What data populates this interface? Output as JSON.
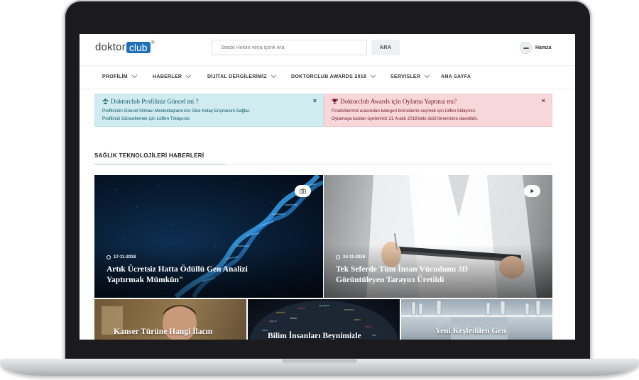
{
  "header": {
    "logo_doktor": "doktor",
    "logo_club": "club",
    "logo_reg": "®",
    "search_placeholder": "Sitede Hekim veya İçerik Ara",
    "search_button": "ARA",
    "user_name": "Hamza"
  },
  "nav": [
    {
      "label": "PROFİLİM",
      "dropdown": true
    },
    {
      "label": "HABERLER",
      "dropdown": true
    },
    {
      "label": "DİJİTAL DERGİLERİMİZ",
      "dropdown": true
    },
    {
      "label": "DOKTORCLUB AWARDS 2018",
      "dropdown": true
    },
    {
      "label": "SERVİSLER",
      "dropdown": true
    },
    {
      "label": "ANA SAYFA",
      "dropdown": false
    }
  ],
  "alerts": {
    "profile": {
      "title": "Doktorclub Profiliniz Güncel mi ?",
      "line1": "Profilinizin Güncel Olması Meslektaşlarınızın Size Kolay Erişmesini Sağlar.",
      "line2": "Profilinizi Güncellemek için Lütfen Tıklayınız.",
      "close": "×",
      "icon": "users-icon"
    },
    "awards": {
      "title": "Doktorclub Awards için Oylama Yaptınız mı?",
      "line1": "Finalistlerimiz arasından kategori birincilerini seçmek için lütfen tıklayınız.",
      "line2": "Oylamaya katılan üyelerimiz 21 Aralık 2018'deki ödül törenimize davetlidir.",
      "close": "×",
      "icon": "trophy-icon"
    }
  },
  "section": {
    "title": "SAĞLIK TEKNOLOJİLERİ HABERLERİ"
  },
  "featured": [
    {
      "date": "17-11-2018",
      "title_line1": "Artık Ücretsiz Hatta Ödüllü Gen Analizi",
      "title_line2": "Yaptırmak Mümkün\"",
      "badge": "camera-icon"
    },
    {
      "date": "24-11-2018",
      "title_line1": "Tek Seferde Tüm İnsan Vücudunu 3D",
      "title_line2": "Görüntüleyen Tarayıcı Üretildi",
      "badge": "play-icon"
    }
  ],
  "small_cards": [
    {
      "title_line1": "Kanser Türüne Hangi İlacın"
    },
    {
      "title_line1": "Bilim İnsanları Beynimizle"
    },
    {
      "title_line1": "Yeni Keşfedilen Gen"
    }
  ],
  "colors": {
    "brand_blue": "#1e6fb8",
    "alert_info_bg": "#d1ecf1",
    "alert_danger_bg": "#f8d7da"
  }
}
